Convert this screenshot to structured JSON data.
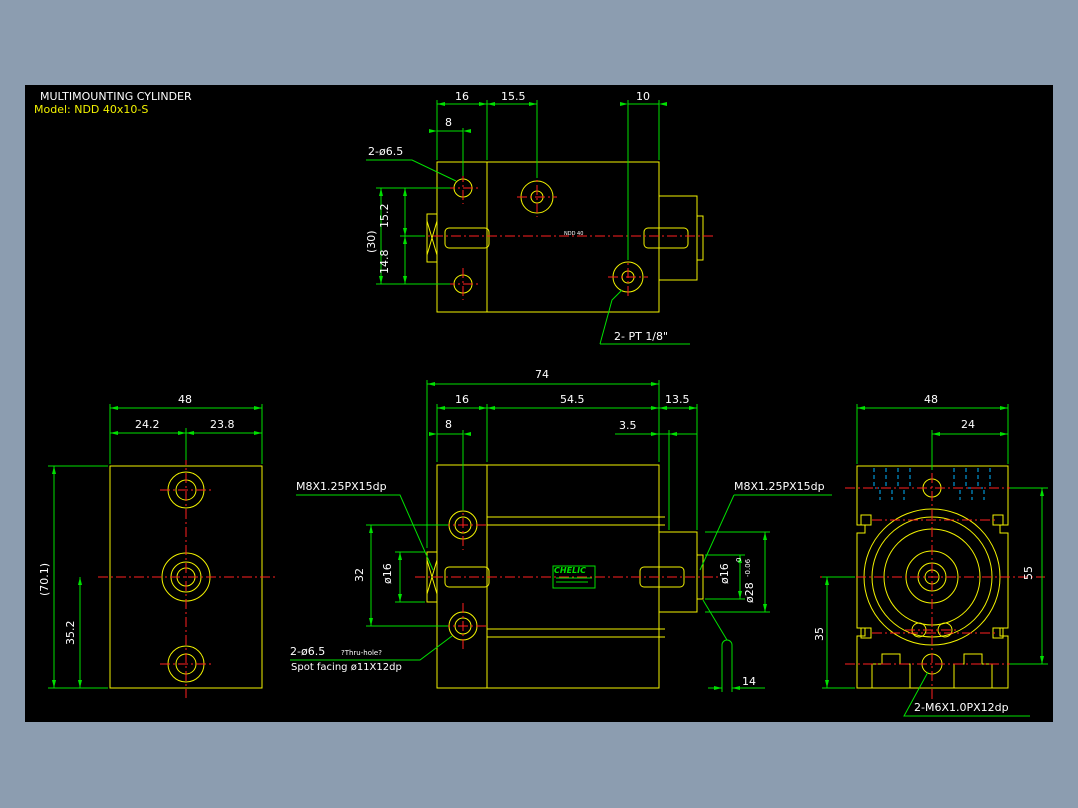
{
  "colors": {
    "background": "#8c9db0",
    "sheet": "#000000",
    "outline": "#f2f200",
    "dimension": "#00e000",
    "centerline": "#ff2020",
    "hidden": "#00b4ff",
    "text_white": "#ffffff"
  },
  "title": {
    "line1": "MULTIMOUNTING CYLINDER",
    "line2": "Model:  NDD 40x10-S"
  },
  "top_view": {
    "dims": [
      "16",
      "15.5",
      "10",
      "8",
      "15.2",
      "14.8",
      "(30)"
    ],
    "callouts": {
      "holes": "2-ø6.5",
      "ports": "2- PT 1/8\""
    },
    "tag": "NDD 40"
  },
  "left_view": {
    "dims": [
      "48",
      "24.2",
      "23.8",
      "(70.1)",
      "35.2"
    ]
  },
  "front_view": {
    "dims": [
      "74",
      "16",
      "54.5",
      "13.5",
      "8",
      "3.5",
      "32",
      "ø16",
      "ø16",
      "ø28",
      "0",
      "-0.06",
      "14"
    ],
    "callouts": {
      "thread_left": "M8X1.25PX15dp",
      "thread_right": "M8X1.25PX15dp",
      "holes_line1": "2-ø6.5",
      "holes_thru": "?Thru-hole?",
      "holes_line2": "Spot facing  ø11X12dp"
    },
    "brand": "CHELIC"
  },
  "right_view": {
    "dims": [
      "48",
      "24",
      "55",
      "35"
    ],
    "callouts": {
      "bottom": "2-M6X1.0PX12dp"
    }
  }
}
